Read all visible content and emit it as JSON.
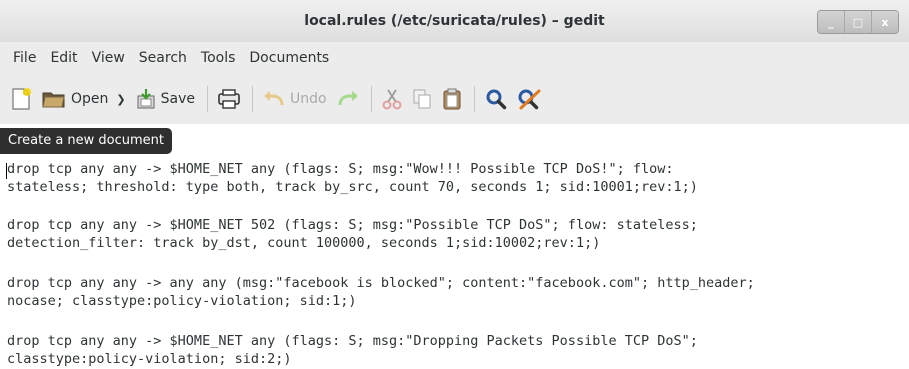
{
  "window": {
    "title": "local.rules (/etc/suricata/rules) – gedit",
    "controls": [
      "_",
      "□",
      "x"
    ]
  },
  "menu": [
    "File",
    "Edit",
    "View",
    "Search",
    "Tools",
    "Documents"
  ],
  "toolbar": {
    "open_label": "Open",
    "save_label": "Save",
    "undo_label": "Undo"
  },
  "tooltip": "Create a new document",
  "editor": {
    "lines": [
      "drop tcp any any -> $HOME_NET any (flags: S; msg:\"Wow!!! Possible TCP DoS!\"; flow:",
      "stateless; threshold: type both, track by_src, count 70, seconds 1; sid:10001;rev:1;)",
      "",
      "drop tcp any any -> $HOME_NET 502 (flags: S; msg:\"Possible TCP DoS\"; flow: stateless;",
      "detection_filter: track by_dst, count 100000, seconds 1;sid:10002;rev:1;)",
      "",
      "drop tcp any any -> any any (msg:\"facebook is blocked\"; content:\"facebook.com\"; http_header;",
      "nocase; classtype:policy-violation; sid:1;)",
      "",
      "drop tcp any any -> $HOME_NET any (flags: S; msg:\"Dropping Packets Possible TCP DoS\";",
      "classtype:policy-violation; sid:2;)"
    ]
  }
}
